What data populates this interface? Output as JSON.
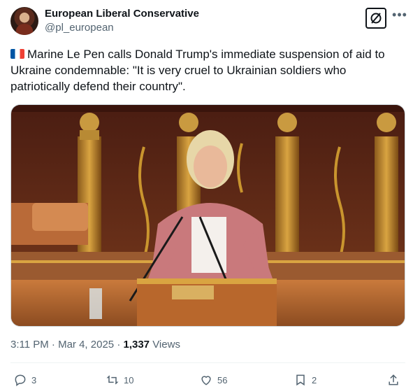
{
  "author": {
    "name": "European Liberal Conservative",
    "handle": "@pl_european"
  },
  "tweet": {
    "flag_icon": "france-flag",
    "text": "Marine Le Pen calls Donald Trump's immediate suspension of aid to Ukraine condemnable: \"It is very cruel to Ukrainian soldiers who patriotically defend their country\"."
  },
  "meta": {
    "time": "3:11 PM",
    "date": "Mar 4, 2025",
    "views_count": "1,337",
    "views_label": "Views"
  },
  "actions": {
    "replies": "3",
    "reposts": "10",
    "likes": "56",
    "bookmarks": "2"
  },
  "colors": {
    "text": "#0f1419",
    "secondary": "#536471",
    "border": "#cfd9de"
  }
}
